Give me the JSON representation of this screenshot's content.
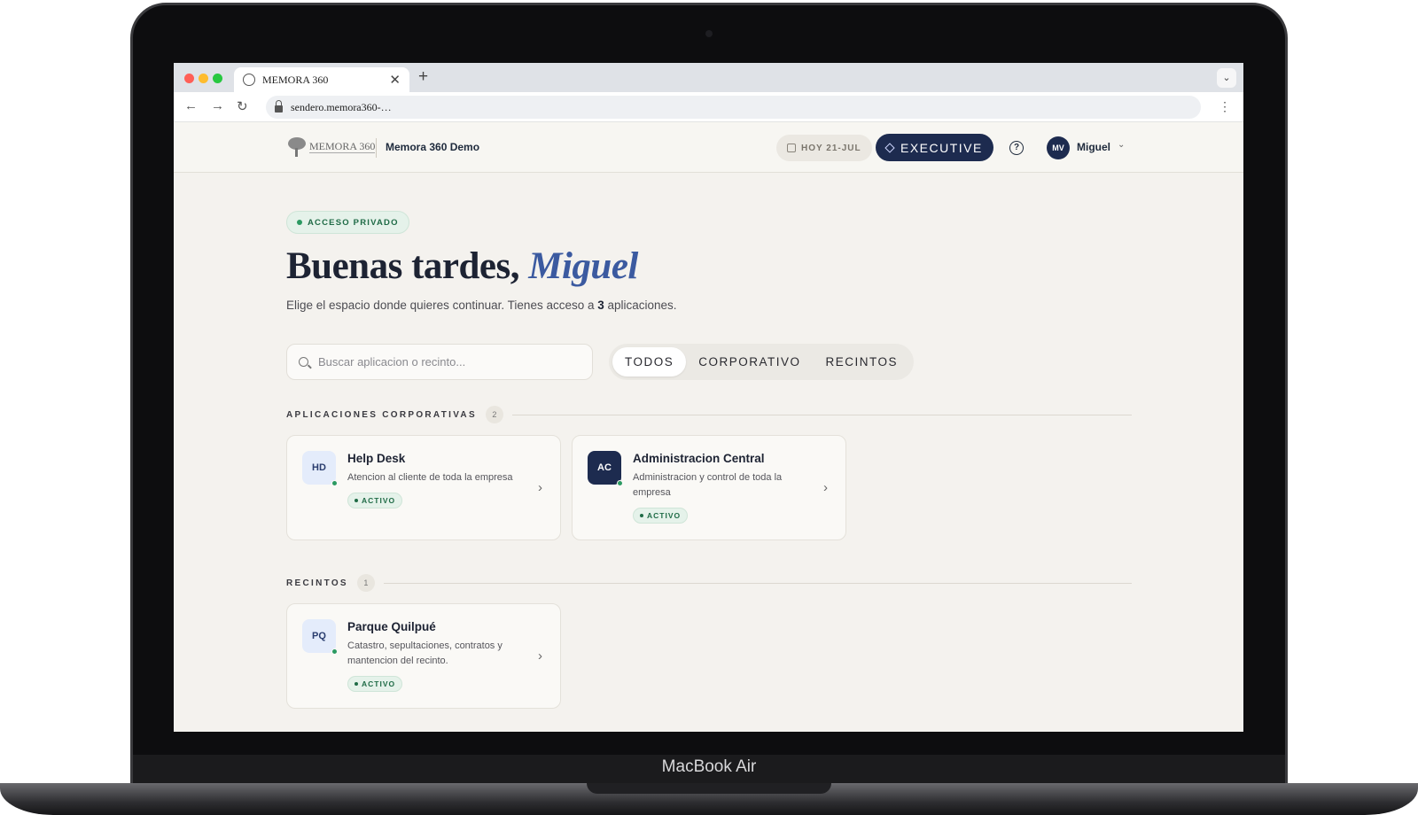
{
  "device": {
    "model": "MacBook Air"
  },
  "browser": {
    "tab_title": "MEMORA 360",
    "url": "sendero.memora360-…",
    "new_tab": "+",
    "close": "✕"
  },
  "header": {
    "logo_text": "MEMORA 360",
    "org_name": "Memora 360 Demo",
    "date_label": "HOY 21-JUL",
    "plan_label": "EXECUTIVE",
    "help_icon": "?",
    "avatar_initials": "MV",
    "user_name": "Miguel"
  },
  "main": {
    "badge": "ACCESO PRIVADO",
    "greeting_prefix": "Buenas tardes, ",
    "greeting_name": "Miguel",
    "subtitle_before": "Elige el espacio donde quieres continuar. Tienes acceso a ",
    "subtitle_count": "3",
    "subtitle_after": " aplicaciones.",
    "search_placeholder": "Buscar aplicacion o recinto...",
    "filters": [
      "TODOS",
      "CORPORATIVO",
      "RECINTOS"
    ]
  },
  "sections": [
    {
      "title": "APLICACIONES CORPORATIVAS",
      "count": "2",
      "apps": [
        {
          "initials": "HD",
          "name": "Help Desk",
          "description": "Atencion al cliente de toda la empresa",
          "status": "ACTIVO"
        },
        {
          "initials": "AC",
          "name": "Administracion Central",
          "description": "Administracion y control de toda la empresa",
          "status": "ACTIVO"
        }
      ]
    },
    {
      "title": "RECINTOS",
      "count": "1",
      "apps": [
        {
          "initials": "PQ",
          "name": "Parque Quilpué",
          "description": "Catastro, sepultaciones, contratos y mantencion del recinto.",
          "status": "ACTIVO"
        }
      ]
    }
  ],
  "colors": {
    "navy": "#1d2b4f",
    "accent_italic": "#3b5aa0",
    "success": "#2b9a62",
    "background": "#f4f2ee"
  }
}
